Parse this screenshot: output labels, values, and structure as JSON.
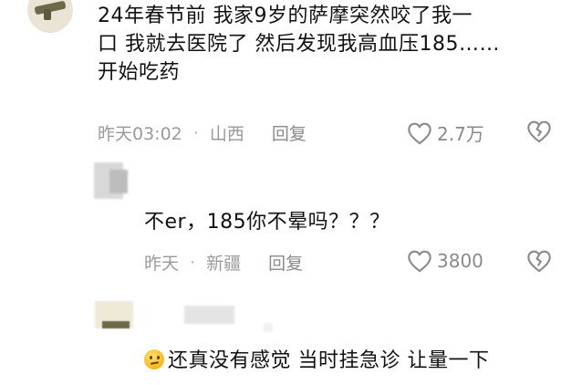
{
  "comments": [
    {
      "text_lines": [
        "24年春节前 我家9岁的萨摩突然咬了我一",
        "口 我就去医院了 然后发现我高血压185……",
        "开始吃药"
      ],
      "time": "昨天03:02",
      "location": "山西",
      "reply_label": "回复",
      "likes": "2.7万"
    },
    {
      "text_lines": [
        "不er，185你不晕吗？？？"
      ],
      "time": "昨天",
      "location": "新疆",
      "reply_label": "回复",
      "likes": "3800"
    },
    {
      "emoji": "thinking-face-icon",
      "text_lines": [
        "还真没有感觉 当时挂急诊 让量一下"
      ]
    }
  ],
  "meta_separator": "·",
  "colors": {
    "text": "#111111",
    "meta": "#9a9a9a",
    "icon": "#8a8a8a"
  }
}
